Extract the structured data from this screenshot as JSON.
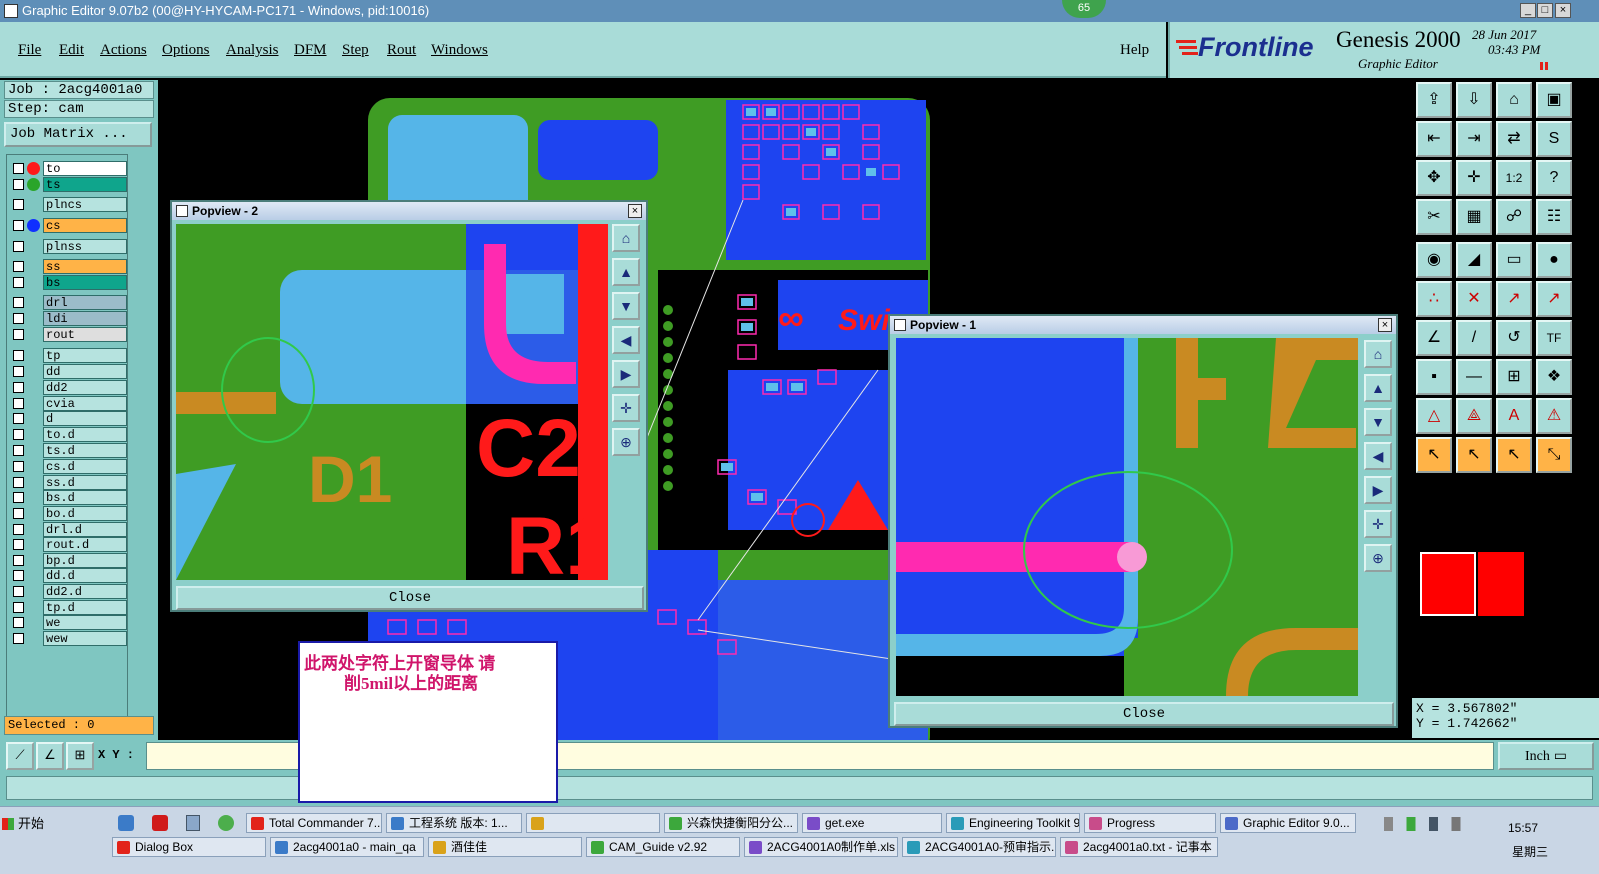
{
  "window": {
    "title": "Graphic Editor 9.07b2 (00@HY-HYCAM-PC171 - Windows, pid:10016)",
    "badge": "65"
  },
  "menu": {
    "items": [
      "File",
      "Edit",
      "Actions",
      "Options",
      "Analysis",
      "DFM",
      "Step",
      "Rout",
      "Windows"
    ],
    "help": "Help"
  },
  "brand": {
    "logo": "Frontline",
    "product": "Genesis 2000",
    "subtitle": "Graphic Editor",
    "date": "28 Jun 2017",
    "time": "03:43 PM"
  },
  "job": {
    "job_label": "Job : 2acg4001a0",
    "step_label": "Step: cam",
    "matrix_button": "Job Matrix ...",
    "selected": "Selected : 0"
  },
  "layers": [
    {
      "name": "to",
      "color": "#ff1a1a",
      "bg": "#ffffff"
    },
    {
      "name": "ts",
      "color": "#2aa52a",
      "bg": "#0fa58c"
    },
    {
      "name": "plncs",
      "color": "",
      "bg": "#b6e3df"
    },
    {
      "name": "cs",
      "color": "#1030ff",
      "bg": "#ffb347"
    },
    {
      "name": "plnss",
      "color": "",
      "bg": "#b6e3df"
    },
    {
      "name": "ss",
      "color": "",
      "bg": "#ffb347"
    },
    {
      "name": "bs",
      "color": "",
      "bg": "#0fa58c"
    },
    {
      "name": "drl",
      "color": "",
      "bg": "#9bbcc9"
    },
    {
      "name": "ldi",
      "color": "",
      "bg": "#9bbcc9"
    },
    {
      "name": "rout",
      "color": "",
      "bg": "#dedede"
    },
    {
      "name": "tp",
      "color": "",
      "bg": "#b6e3df"
    },
    {
      "name": "dd",
      "color": "",
      "bg": "#b6e3df"
    },
    {
      "name": "dd2",
      "color": "",
      "bg": "#b6e3df"
    },
    {
      "name": "cvia",
      "color": "",
      "bg": "#b6e3df"
    },
    {
      "name": "d",
      "color": "",
      "bg": "#b6e3df"
    },
    {
      "name": "to.d",
      "color": "",
      "bg": "#b6e3df"
    },
    {
      "name": "ts.d",
      "color": "",
      "bg": "#b6e3df"
    },
    {
      "name": "cs.d",
      "color": "",
      "bg": "#b6e3df"
    },
    {
      "name": "ss.d",
      "color": "",
      "bg": "#b6e3df"
    },
    {
      "name": "bs.d",
      "color": "",
      "bg": "#b6e3df"
    },
    {
      "name": "bo.d",
      "color": "",
      "bg": "#b6e3df"
    },
    {
      "name": "drl.d",
      "color": "",
      "bg": "#b6e3df"
    },
    {
      "name": "rout.d",
      "color": "",
      "bg": "#b6e3df"
    },
    {
      "name": "bp.d",
      "color": "",
      "bg": "#b6e3df"
    },
    {
      "name": "dd.d",
      "color": "",
      "bg": "#b6e3df"
    },
    {
      "name": "dd2.d",
      "color": "",
      "bg": "#b6e3df"
    },
    {
      "name": "tp.d",
      "color": "",
      "bg": "#b6e3df"
    },
    {
      "name": "we",
      "color": "",
      "bg": "#b6e3df"
    },
    {
      "name": "wew",
      "color": "",
      "bg": "#b6e3df"
    }
  ],
  "popview2": {
    "title": "Popview - 2",
    "close": "Close",
    "labels": {
      "d1": "D1",
      "c2": "C2",
      "r1": "R1"
    }
  },
  "popview1": {
    "title": "Popview - 1",
    "close": "Close"
  },
  "note": {
    "line1": "此两处字符上开窗导体   请",
    "line2": "削5mil以上的距离"
  },
  "board": {
    "brand_text": "Swi"
  },
  "coords": {
    "x": "X = 3.567802\"",
    "y": "Y = 1.742662\"",
    "xy_label": "X Y :",
    "units": "Inch"
  },
  "taskbar": {
    "start": "开始",
    "row1": [
      "Total Commander 7....",
      "工程系统  版本: 1...",
      "",
      "兴森快捷衡阳分公...",
      "get.exe",
      "Engineering Toolkit 9...",
      "Progress",
      "Graphic Editor 9.0..."
    ],
    "row2": [
      "Dialog Box",
      "2acg4001a0 - main_qa",
      "酒佳佳",
      "CAM_Guide v2.92",
      "2ACG4001A0制作单.xls ...",
      "2ACG4001A0-预审指示....",
      "2acg4001a0.txt - 记事本"
    ],
    "clock": "15:57",
    "day": "星期三"
  }
}
